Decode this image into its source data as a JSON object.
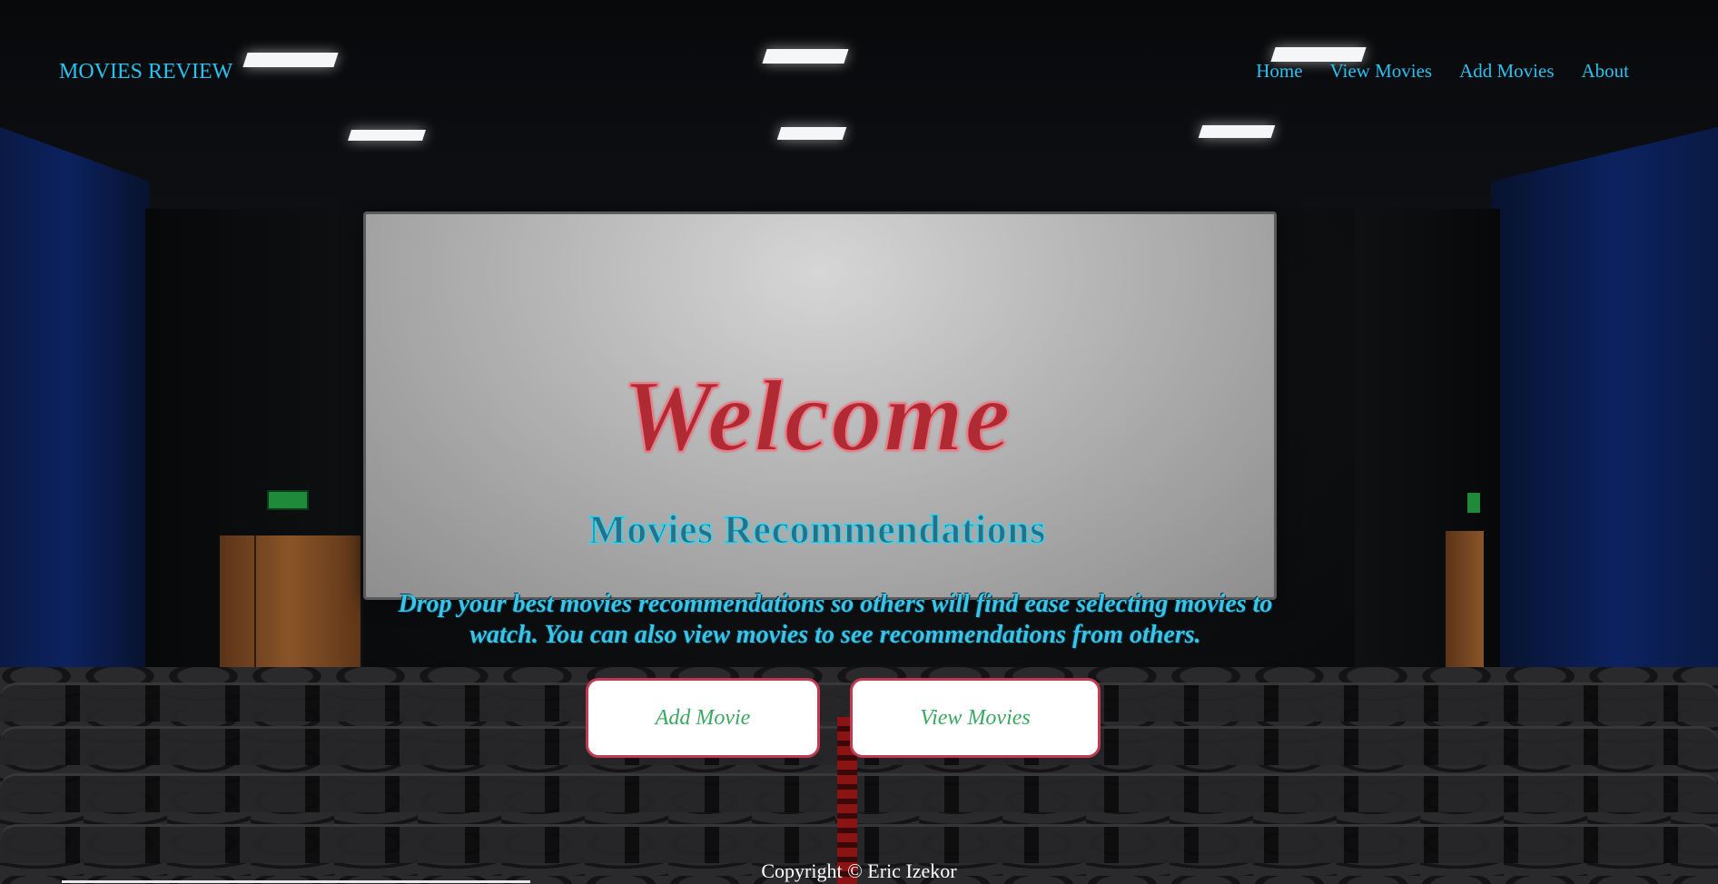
{
  "header": {
    "brand": "MOVIES REVIEW",
    "nav": {
      "home": "Home",
      "view_movies": "View Movies",
      "add_movies": "Add Movies",
      "about": "About"
    }
  },
  "hero": {
    "welcome": "Welcome",
    "subtitle": "Movies Recommendations",
    "description": "Drop your best movies recommendations so others will find ease selecting movies to watch. You can also view movies to see recommendations from others.",
    "buttons": {
      "add_movie": "Add Movie",
      "view_movies": "View Movies"
    }
  },
  "footer": {
    "copyright": "Copyright © Eric Izekor"
  },
  "colors": {
    "nav_text": "#29c2f0",
    "welcome_fill": "#b02a34",
    "subtitle_stroke": "#3ad3ee",
    "button_border": "#c03a52",
    "button_text": "#3aa860"
  },
  "background": {
    "description_icon": "cinema-hall-background"
  }
}
